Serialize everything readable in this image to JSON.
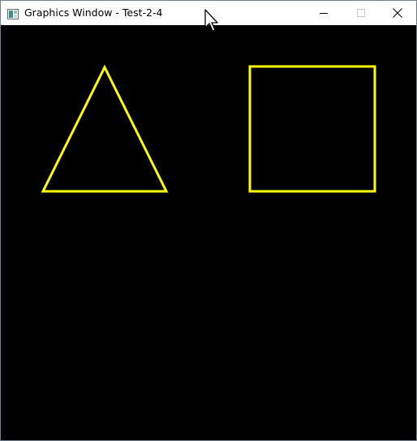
{
  "window": {
    "title": "Graphics Window - Test-2-4",
    "titlebar_color": "#ffffff",
    "canvas_color": "#000000",
    "controls": [
      "minimize-icon",
      "maximize-icon",
      "close-icon"
    ]
  },
  "canvas": {
    "stroke_color": "#ffff00",
    "shapes": [
      {
        "type": "triangle",
        "outline": true
      },
      {
        "type": "square",
        "outline": true
      }
    ]
  },
  "cursor": {
    "icon": "arrow-cursor-icon"
  }
}
